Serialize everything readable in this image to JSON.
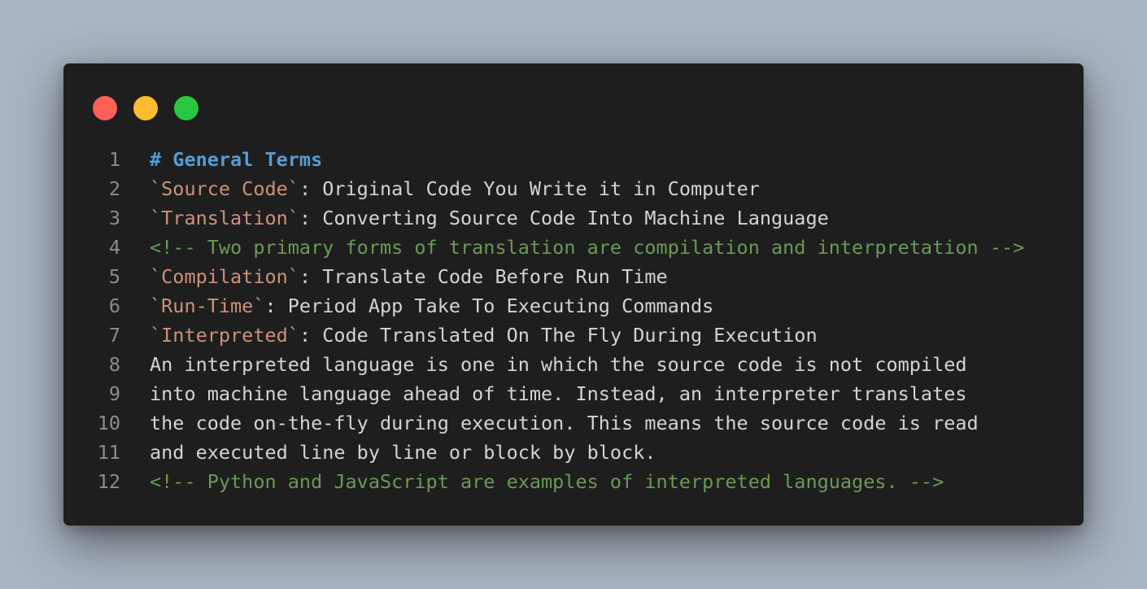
{
  "colors": {
    "background": "#a9b4c1",
    "window": "#1e1e1e",
    "close": "#ff5f57",
    "minimize": "#febc2e",
    "maximize": "#28c840",
    "heading": "#569cd6",
    "code": "#ce9178",
    "comment": "#6a9955",
    "text": "#d4d4d4",
    "line_number": "#8c8c8c"
  },
  "window": {
    "controls": [
      {
        "name": "close-button"
      },
      {
        "name": "minimize-button"
      },
      {
        "name": "maximize-button"
      }
    ]
  },
  "lines": [
    {
      "num": "1",
      "heading": "# General Terms"
    },
    {
      "num": "2",
      "code": "`Source Code`",
      "rest": ": Original Code You Write it in Computer"
    },
    {
      "num": "3",
      "code": "`Translation`",
      "rest": ": Converting Source Code Into Machine Language"
    },
    {
      "num": "4",
      "comment": "<!-- Two primary forms of translation are compilation and interpretation -->"
    },
    {
      "num": "5",
      "code": "`Compilation`",
      "rest": ": Translate Code Before Run Time"
    },
    {
      "num": "6",
      "code": "`Run-Time`",
      "rest": ": Period App Take To Executing Commands"
    },
    {
      "num": "7",
      "code": "`Interpreted`",
      "rest": ": Code Translated On The Fly During Execution"
    },
    {
      "num": "8",
      "text": "An interpreted language is one in which the source code is not compiled"
    },
    {
      "num": "9",
      "text": "into machine language ahead of time. Instead, an interpreter translates"
    },
    {
      "num": "10",
      "text": "the code on-the-fly during execution. This means the source code is read"
    },
    {
      "num": "11",
      "text": "and executed line by line or block by block."
    },
    {
      "num": "12",
      "comment": "<!-- Python and JavaScript are examples of interpreted languages. -->"
    }
  ]
}
